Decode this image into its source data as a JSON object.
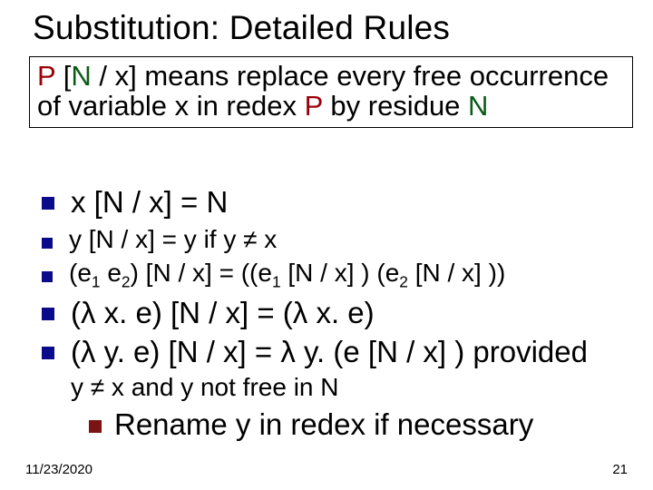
{
  "title": "Substitution: Detailed Rules",
  "def": {
    "pre": " [",
    "sep": " / ",
    "post": "] means replace every free occurrence of variable ",
    "mid2": " in redex ",
    "mid3": " by residue ",
    "P": "P",
    "x": "x",
    "N": "N"
  },
  "rules": {
    "r1": "x [N / x] = N",
    "r2": "y [N / x] = y if y ≠ x",
    "r3_a": "(e",
    "r3_b": " e",
    "r3_c": ") [N / x] = ((e",
    "r3_d": " [N / x] ) (e",
    "r3_e": " [N / x] ))",
    "s1": "1",
    "s2": "2",
    "r4": "(λ x. e) [N / x] = (λ x. e)",
    "r5": "(λ y. e) [N / x] = λ y. (e [N / x] ) provided",
    "r5cond": "y ≠ x and y not free in N",
    "nested": "Rename y in redex if necessary"
  },
  "footer": {
    "date": "11/23/2020",
    "num": "21"
  }
}
